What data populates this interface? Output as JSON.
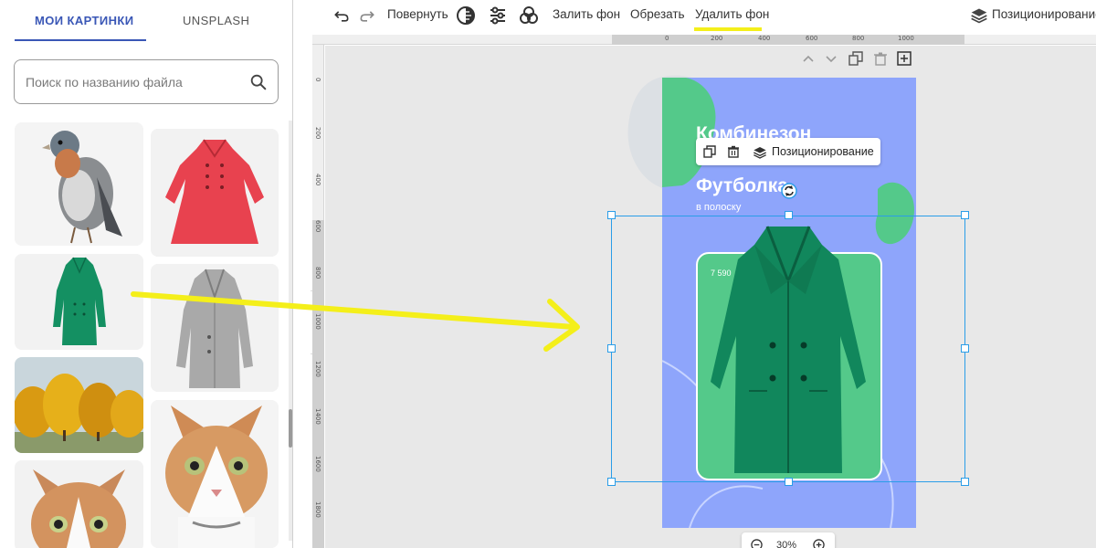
{
  "sidebar": {
    "tabs": [
      {
        "label": "МОИ КАРТИНКИ",
        "active": true
      },
      {
        "label": "UNSPLASH",
        "active": false
      }
    ],
    "search": {
      "placeholder": "Поиск по названию файла",
      "value": ""
    },
    "images": [
      {
        "icon": "bird-image"
      },
      {
        "icon": "red-coat-image"
      },
      {
        "icon": "green-coat-image"
      },
      {
        "icon": "grey-coat-image"
      },
      {
        "icon": "autumn-trees-image"
      },
      {
        "icon": "cat-image"
      },
      {
        "icon": "cat-image"
      }
    ]
  },
  "toolbar": {
    "undo_icon": "undo-icon",
    "redo_icon": "redo-icon",
    "rotate_label": "Повернуть",
    "contrast_icon": "contrast-icon",
    "adjust_icon": "sliders-icon",
    "blend_icon": "circles-icon",
    "fill_bg_label": "Залить фон",
    "crop_label": "Обрезать",
    "remove_bg_label": "Удалить фон",
    "positioning_label": "Позиционирование",
    "highlight_color": "#f4ef1a"
  },
  "ruler": {
    "top_labels": [
      "0",
      "200",
      "400",
      "600",
      "800",
      "1000"
    ],
    "left_labels": [
      "0",
      "200",
      "400",
      "600",
      "800",
      "1000",
      "1200",
      "1400",
      "1600",
      "1800"
    ]
  },
  "canvas": {
    "artboard": {
      "title1": "Комбинезон",
      "title2": "Футболка",
      "subtitle": "в полоску",
      "price": "7 590",
      "background": "#8ea5fb",
      "card_color": "#54c98a"
    },
    "context_menu": {
      "positioning_label": "Позиционирование"
    },
    "zoom": {
      "value": "30%"
    },
    "selection_color": "#2a9de8",
    "arrow_color": "#f4ef1a"
  }
}
